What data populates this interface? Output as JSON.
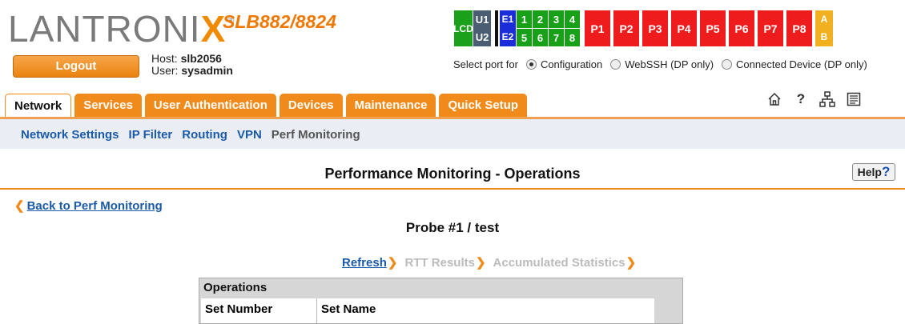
{
  "brand": {
    "logo_main": "LANTRONI",
    "logo_x": "X",
    "logo_reg": "®",
    "model": "SLB882/8824"
  },
  "session": {
    "logout_label": "Logout",
    "host_label": "Host:",
    "host_value": "slb2056",
    "user_label": "User:",
    "user_value": "sysadmin"
  },
  "ports": {
    "lcd": "LCD",
    "u1": "U1",
    "u2": "U2",
    "e1": "E1",
    "e2": "E2",
    "grid": [
      "1",
      "2",
      "3",
      "4",
      "5",
      "6",
      "7",
      "8"
    ],
    "power": [
      "P1",
      "P2",
      "P3",
      "P4",
      "P5",
      "P6",
      "P7",
      "P8"
    ],
    "a": "A",
    "b": "B",
    "colors": {
      "lcd": "#1aa01a",
      "usb": "#4a5d72",
      "eth": "#1b2dd8",
      "serial": "#18a018",
      "power": "#ee1c1c",
      "ab": "#f0b020"
    }
  },
  "select_port": {
    "label": "Select port for",
    "options": [
      "Configuration",
      "WebSSH (DP only)",
      "Connected Device (DP only)"
    ],
    "selected": "Configuration"
  },
  "tabs": [
    {
      "label": "Network",
      "active": true
    },
    {
      "label": "Services",
      "active": false
    },
    {
      "label": "User Authentication",
      "active": false
    },
    {
      "label": "Devices",
      "active": false
    },
    {
      "label": "Maintenance",
      "active": false
    },
    {
      "label": "Quick Setup",
      "active": false
    }
  ],
  "toolbar_icons": [
    "home-icon",
    "help-icon",
    "sitemap-icon",
    "log-icon"
  ],
  "subnav": [
    {
      "label": "Network Settings",
      "current": false
    },
    {
      "label": "IP Filter",
      "current": false
    },
    {
      "label": "Routing",
      "current": false
    },
    {
      "label": "VPN",
      "current": false
    },
    {
      "label": "Perf Monitoring",
      "current": true
    }
  ],
  "page": {
    "title": "Performance Monitoring - Operations",
    "help_label": "Help",
    "help_q": "?",
    "back_link": "Back to Perf Monitoring",
    "probe_title": "Probe #1 / test"
  },
  "actions": [
    {
      "label": "Refresh",
      "enabled": true
    },
    {
      "label": "RTT Results",
      "enabled": false
    },
    {
      "label": "Accumulated Statistics",
      "enabled": false
    }
  ],
  "table": {
    "header": "Operations",
    "columns": [
      "Set Number",
      "Set Name"
    ]
  },
  "theme": {
    "accent": "#f08a1a",
    "link": "#1b5aa8"
  }
}
